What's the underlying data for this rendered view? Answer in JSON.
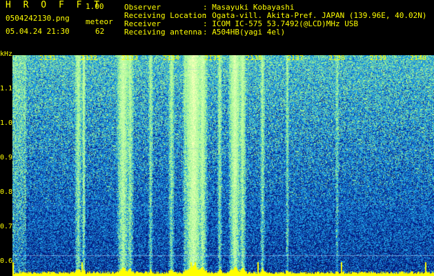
{
  "header": {
    "title": "H R O F F T",
    "version": "1.00",
    "filename": "0504242130.png",
    "timestamp": "05.04.24 21:30",
    "event_label": "meteor",
    "event_count": "62"
  },
  "info": [
    {
      "label": "Observer",
      "value": ": Masayuki Kobayashi"
    },
    {
      "label": "Receiving Location",
      "value": ": Ogata-vill. Akita-Pref. JAPAN (139.96E, 40.02N)"
    },
    {
      "label": "Receiver",
      "value": ": ICOM IC-575 53.7492(@LCD)MHz USB"
    },
    {
      "label": "Receiving antenna",
      "value": ": A504HB(yagi 4el)"
    }
  ],
  "axis": {
    "unit": "kHz",
    "y_ticks": [
      "1.1",
      "1.0",
      "0.9",
      "0.8",
      "0.7",
      "0.6"
    ],
    "x_ticks": [
      "2131",
      "2132",
      "2133",
      "2134",
      "2135",
      "2136",
      "2137",
      "2138",
      "2139",
      "2140"
    ]
  },
  "colors": {
    "text": "#ffff00",
    "background": "#000000",
    "spectrogram_low": "#0a1a8a",
    "spectrogram_mid": "#2a7fd8",
    "spectrogram_high": "#7cf07c",
    "baseline": "#ffff00"
  }
}
